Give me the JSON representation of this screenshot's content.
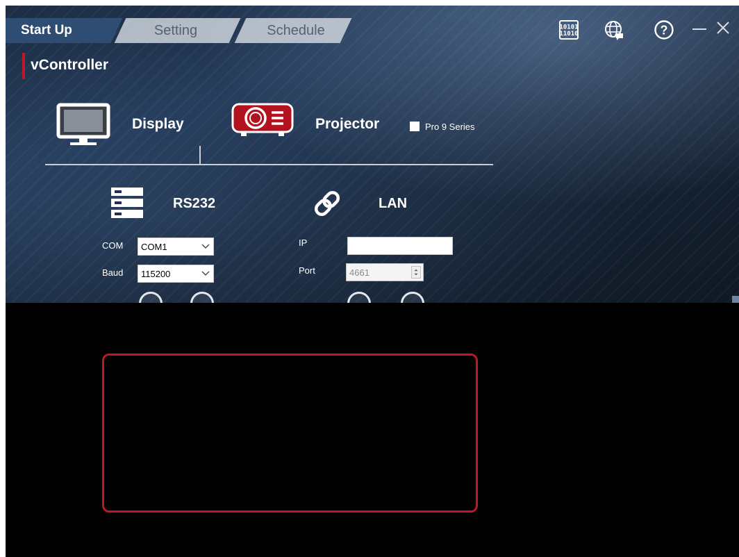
{
  "tabs": [
    {
      "label": "Start Up",
      "active": true
    },
    {
      "label": "Setting",
      "active": false
    },
    {
      "label": "Schedule",
      "active": false
    }
  ],
  "top_icons": [
    "binary-icon",
    "globe-icon",
    "help-icon",
    "minimize-icon",
    "close-icon"
  ],
  "app": {
    "title": "vController",
    "accent_color": "#c0182a"
  },
  "devices": {
    "display_label": "Display",
    "projector_label": "Projector",
    "projector_selected": true,
    "pro9_label": "Pro 9 Series",
    "pro9_checked": false
  },
  "rs232": {
    "title": "RS232",
    "com_label": "COM",
    "com_value": "COM1",
    "baud_label": "Baud",
    "baud_value": "115200"
  },
  "lan": {
    "title": "LAN",
    "ip_label": "IP",
    "ip_value": "",
    "port_label": "Port",
    "port_value": "4661"
  },
  "colors": {
    "highlight_border": "#c1152b",
    "panel_bg": "#1d2d44",
    "lower_bg": "#000000"
  }
}
